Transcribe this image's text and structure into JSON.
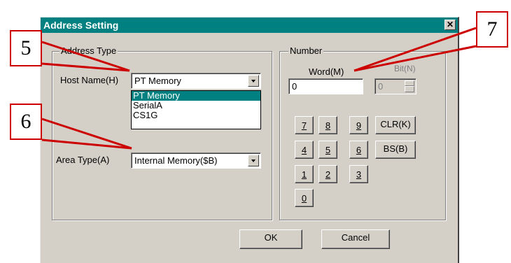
{
  "dialog": {
    "title": "Address Setting",
    "close_glyph": "✕"
  },
  "address_type": {
    "group_label": "Address Type",
    "host_name_label": "Host Name(H)",
    "host_name_value": "PT Memory",
    "host_name_options": [
      "PT Memory",
      "SerialA",
      "CS1G"
    ],
    "area_type_label": "Area Type(A)",
    "area_type_value": "Internal Memory($B)"
  },
  "number": {
    "group_label": "Number",
    "word_label": "Word(M)",
    "word_value": "0",
    "bit_label": "Bit(N)",
    "bit_value": "0",
    "keys": [
      "7",
      "8",
      "9",
      "4",
      "5",
      "6",
      "1",
      "2",
      "3",
      "0"
    ],
    "clr_label": "CLR(K)",
    "bs_label": "BS(B)"
  },
  "buttons": {
    "ok_label": "OK",
    "cancel_label": "Cancel"
  },
  "callouts": [
    "5",
    "6",
    "7"
  ],
  "colors": {
    "titlebar": "#008080",
    "selection": "#008080",
    "callout_border": "#cc0000",
    "dialog_face": "#d4d0c8"
  }
}
